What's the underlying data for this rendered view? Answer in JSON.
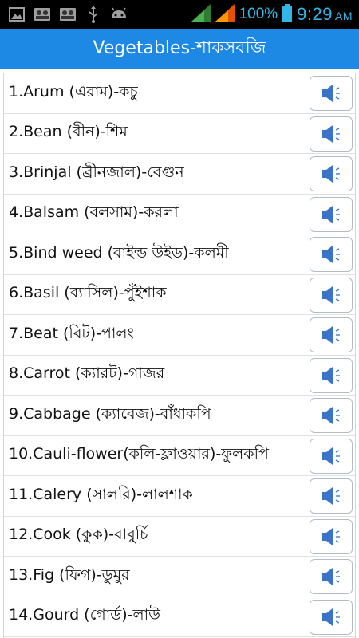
{
  "status_bar": {
    "left_icons": [
      "gallery-icon",
      "contacts-icon",
      "contacts-icon-2",
      "usb-icon",
      "android-icon"
    ],
    "battery_percent": "100%",
    "time": "9:29",
    "ampm": "AM",
    "signal_colors": {
      "sim1": "#4caf50",
      "sim2": "#ff9800"
    },
    "battery_color": "#33b5e5"
  },
  "header": {
    "title": "Vegetables-শাকসবজি",
    "bg_color": "#1e88e5"
  },
  "items": [
    {
      "label": "1.Arum (এরাম)-কচু"
    },
    {
      "label": "2.Bean (বীন)-শিম"
    },
    {
      "label": "3.Brinjal (ব্রীনজাল)-বেগুন"
    },
    {
      "label": "4.Balsam (বলসাম)-করলা"
    },
    {
      "label": "5.Bind weed (বাইল্ড উইড)-কলমী"
    },
    {
      "label": "6.Basil (ব্যাসিল)-পুঁইশাক"
    },
    {
      "label": "7.Beat (বিট)-পালং"
    },
    {
      "label": "8.Carrot (ক্যারট)-গাজর"
    },
    {
      "label": "9.Cabbage (ক্যাবেজ)-বাঁধাকপি"
    },
    {
      "label": "10.Cauli-flower(কলি-ফ্লাওয়ার)-ফুলকপি"
    },
    {
      "label": "11.Calery (সালরি)-লালশাক"
    },
    {
      "label": "12.Cook (কুক)-বাবুর্চি"
    },
    {
      "label": "13.Fig (ফিগ)-ডুমুর"
    },
    {
      "label": "14.Gourd (গোর্ড)-লাউ"
    }
  ],
  "speaker_icon": "speaker-icon",
  "speaker_color": "#3b73c8"
}
